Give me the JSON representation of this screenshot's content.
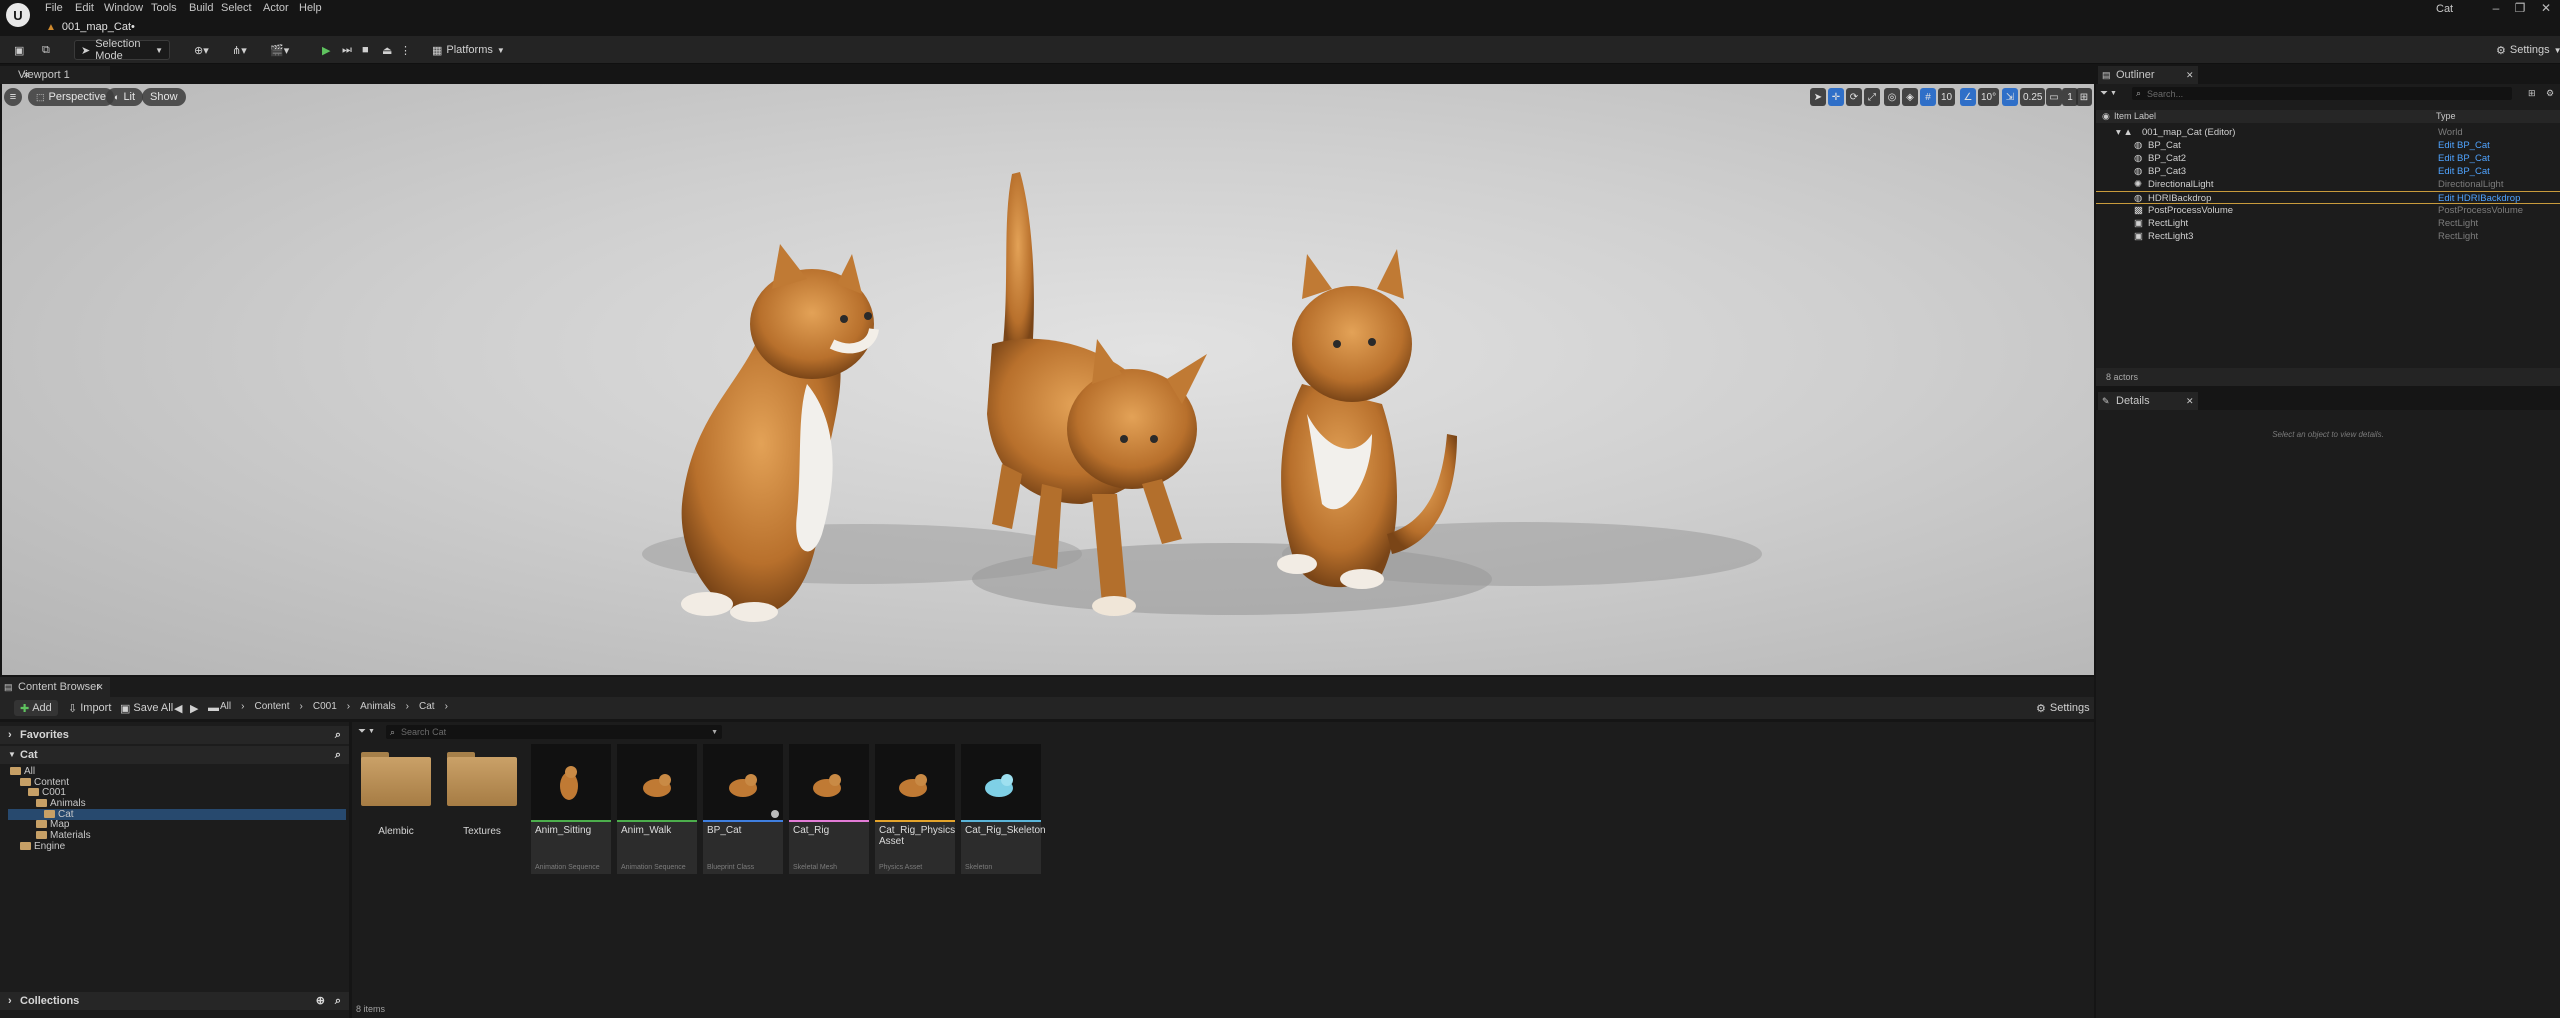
{
  "menu": {
    "items": [
      "File",
      "Edit",
      "Window",
      "Tools",
      "Build",
      "Select",
      "Actor",
      "Help"
    ]
  },
  "window": {
    "title": "Cat",
    "map_tab": "001_map_Cat•"
  },
  "toolbar": {
    "selection_mode": "Selection Mode",
    "platforms": "Platforms",
    "settings": "Settings"
  },
  "viewport": {
    "tab": "Viewport 1",
    "perspective": "Perspective",
    "lit": "Lit",
    "show": "Show",
    "grid_value": "10",
    "angle_value": "10°",
    "scale_value": "0.25",
    "camera_speed": "1"
  },
  "content_browser": {
    "tab": "Content Browser",
    "add": "Add",
    "import": "Import",
    "save_all": "Save All",
    "breadcrumb": [
      "All",
      "Content",
      "C001",
      "Animals",
      "Cat"
    ],
    "settings": "Settings",
    "favorites": "Favorites",
    "tree_root": "Cat",
    "tree": [
      {
        "label": "All",
        "depth": 0
      },
      {
        "label": "Content",
        "depth": 1
      },
      {
        "label": "C001",
        "depth": 2
      },
      {
        "label": "Animals",
        "depth": 3
      },
      {
        "label": "Cat",
        "depth": 4,
        "selected": true
      },
      {
        "label": "Map",
        "depth": 3
      },
      {
        "label": "Materials",
        "depth": 3
      },
      {
        "label": "Engine",
        "depth": 1
      }
    ],
    "collections": "Collections",
    "search_placeholder": "Search Cat",
    "folders": [
      "Alembic",
      "Textures"
    ],
    "assets": [
      {
        "name": "Anim_Sitting",
        "type": "Animation Sequence",
        "color": "#4cae4c"
      },
      {
        "name": "Anim_Walk",
        "type": "Animation Sequence",
        "color": "#4cae4c"
      },
      {
        "name": "BP_Cat",
        "type": "Blueprint Class",
        "color": "#3f7fe0"
      },
      {
        "name": "Cat_Rig",
        "type": "Skeletal Mesh",
        "color": "#e27bd6"
      },
      {
        "name": "Cat_Rig_Physics Asset",
        "type": "Physics Asset",
        "color": "#e3a32b"
      },
      {
        "name": "Cat_Rig_Skeleton",
        "type": "Skeleton",
        "color": "#5ab4d8"
      }
    ],
    "item_count": "8 items"
  },
  "outliner": {
    "tab": "Outliner",
    "search_placeholder": "Search...",
    "col_label": "Item Label",
    "col_type": "Type",
    "rows": [
      {
        "label": "001_map_Cat (Editor)",
        "type": "World",
        "indent": 1,
        "link": false
      },
      {
        "label": "BP_Cat",
        "type": "Edit BP_Cat",
        "indent": 2,
        "link": true
      },
      {
        "label": "BP_Cat2",
        "type": "Edit BP_Cat",
        "indent": 2,
        "link": true
      },
      {
        "label": "BP_Cat3",
        "type": "Edit BP_Cat",
        "indent": 2,
        "link": true
      },
      {
        "label": "DirectionalLight",
        "type": "DirectionalLight",
        "indent": 2,
        "link": false
      },
      {
        "label": "HDRIBackdrop",
        "type": "Edit HDRIBackdrop",
        "indent": 2,
        "link": true
      },
      {
        "label": "PostProcessVolume",
        "type": "PostProcessVolume",
        "indent": 2,
        "link": false
      },
      {
        "label": "RectLight",
        "type": "RectLight",
        "indent": 2,
        "link": false
      },
      {
        "label": "RectLight3",
        "type": "RectLight",
        "indent": 2,
        "link": false
      }
    ],
    "count": "8 actors"
  },
  "details": {
    "tab": "Details",
    "empty": "Select an object to view details."
  }
}
